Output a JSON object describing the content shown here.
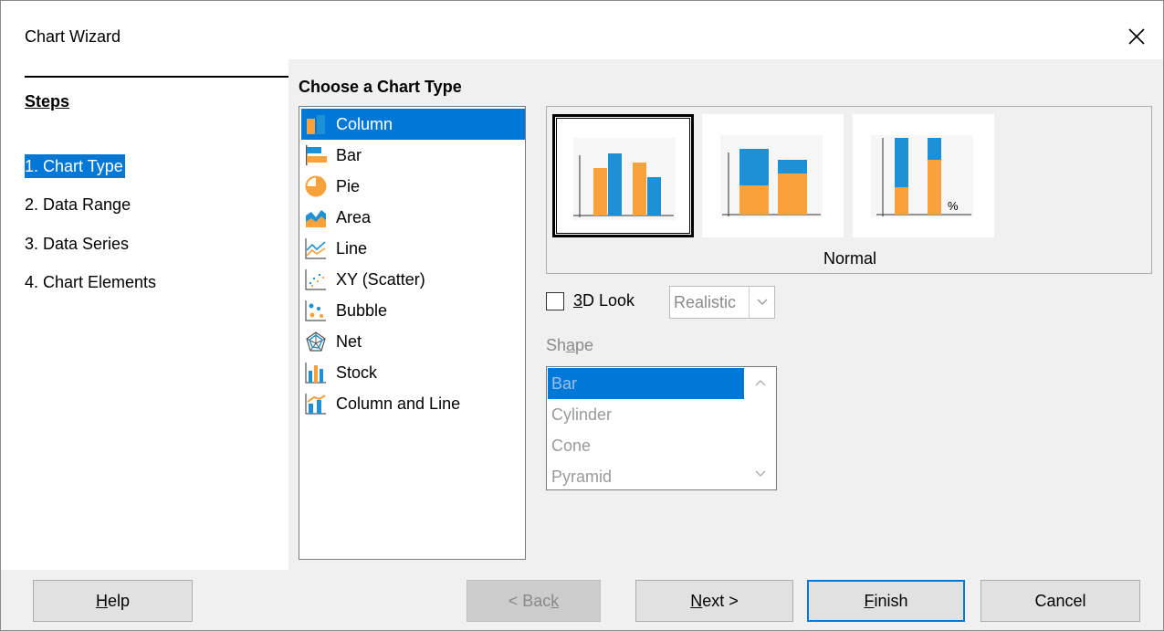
{
  "window": {
    "title": "Chart Wizard"
  },
  "steps": {
    "title": "Steps",
    "items": [
      {
        "label": "1. Chart Type"
      },
      {
        "label": "2. Data Range"
      },
      {
        "label": "3. Data Series"
      },
      {
        "label": "4. Chart Elements"
      }
    ]
  },
  "content": {
    "title": "Choose a Chart Type"
  },
  "chart_types": [
    {
      "label": "Column",
      "icon": "column-chart-icon"
    },
    {
      "label": "Bar",
      "icon": "bar-chart-icon"
    },
    {
      "label": "Pie",
      "icon": "pie-chart-icon"
    },
    {
      "label": "Area",
      "icon": "area-chart-icon"
    },
    {
      "label": "Line",
      "icon": "line-chart-icon"
    },
    {
      "label": "XY (Scatter)",
      "icon": "scatter-chart-icon"
    },
    {
      "label": "Bubble",
      "icon": "bubble-chart-icon"
    },
    {
      "label": "Net",
      "icon": "net-chart-icon"
    },
    {
      "label": "Stock",
      "icon": "stock-chart-icon"
    },
    {
      "label": "Column and Line",
      "icon": "column-and-line-chart-icon"
    }
  ],
  "variants": {
    "selected_label": "Normal",
    "percent_symbol": "%"
  },
  "options": {
    "look_3d_prefix": "",
    "look_3d_mnemonic": "3",
    "look_3d_rest": "D Look",
    "look_3d_checked": false,
    "look_style_value": "Realistic",
    "shape_label_pre": "Sh",
    "shape_label_mnemonic": "a",
    "shape_label_post": "pe",
    "shapes": [
      "Bar",
      "Cylinder",
      "Cone",
      "Pyramid"
    ]
  },
  "buttons": {
    "help_mnemonic": "H",
    "help_rest": "elp",
    "back_pre": "< Bac",
    "back_mnemonic": "k",
    "next_mnemonic": "N",
    "next_rest": "ext >",
    "finish_mnemonic": "F",
    "finish_rest": "inish",
    "cancel": "Cancel"
  },
  "colors": {
    "accent": "#0078d7",
    "chart_blue": "#1e90d6",
    "chart_orange": "#f9a23c"
  }
}
